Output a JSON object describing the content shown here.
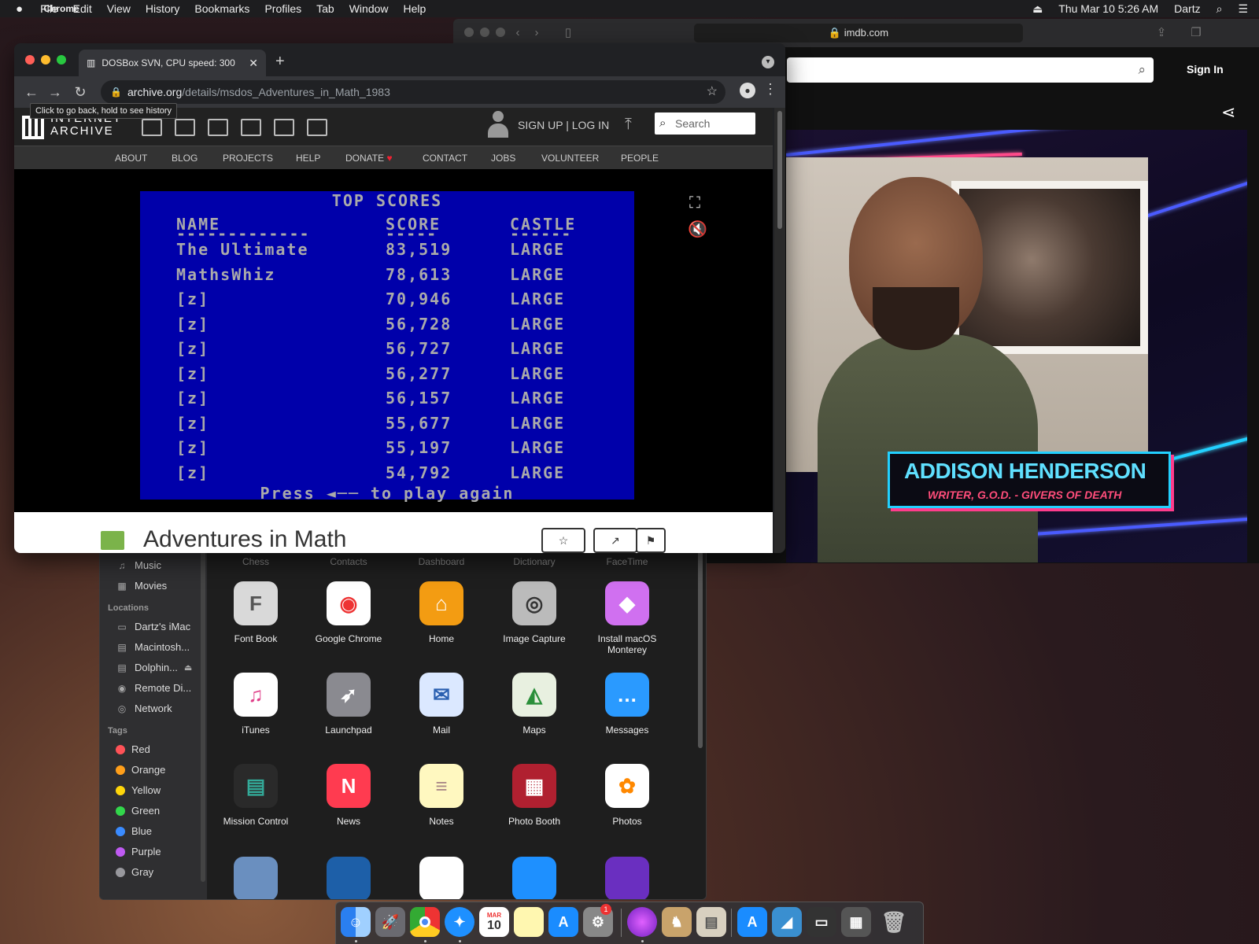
{
  "menubar": {
    "apple": "",
    "items": [
      "Chrome",
      "File",
      "Edit",
      "View",
      "History",
      "Bookmarks",
      "Profiles",
      "Tab",
      "Window",
      "Help"
    ],
    "datetime": "Thu Mar 10  5:26 AM",
    "user": "Dartz"
  },
  "safari": {
    "url": "imdb.com",
    "sign_in": "Sign In",
    "lower_third_name": "ADDISON HENDERSON",
    "lower_third_role": "WRITER, G.O.D. - GIVERS OF DEATH"
  },
  "chrome": {
    "tab_title": "DOSBox SVN, CPU speed: 300",
    "url_host": "archive.org",
    "url_path": "/details/msdos_Adventures_in_Math_1983",
    "tooltip": "Click to go back, hold to see history"
  },
  "ia": {
    "logo_line1": "INTERNET",
    "logo_line2": "ARCHIVE",
    "signup": "SIGN UP | LOG IN",
    "search_placeholder": "Search",
    "nav": [
      "ABOUT",
      "BLOG",
      "PROJECTS",
      "HELP",
      "DONATE",
      "CONTACT",
      "JOBS",
      "VOLUNTEER",
      "PEOPLE"
    ],
    "item_title": "Adventures in Math"
  },
  "dos": {
    "title": "TOP SCORES",
    "headers": {
      "name": "NAME",
      "score": "SCORE",
      "castle": "CASTLE"
    },
    "rows": [
      {
        "name": "The Ultimate",
        "score": "83,519",
        "castle": "LARGE"
      },
      {
        "name": "MathsWhiz",
        "score": "78,613",
        "castle": "LARGE"
      },
      {
        "name": "[z]",
        "score": "70,946",
        "castle": "LARGE"
      },
      {
        "name": "[z]",
        "score": "56,728",
        "castle": "LARGE"
      },
      {
        "name": "[z]",
        "score": "56,727",
        "castle": "LARGE"
      },
      {
        "name": "[z]",
        "score": "56,277",
        "castle": "LARGE"
      },
      {
        "name": "[z]",
        "score": "56,157",
        "castle": "LARGE"
      },
      {
        "name": "[z]",
        "score": "55,677",
        "castle": "LARGE"
      },
      {
        "name": "[z]",
        "score": "55,197",
        "castle": "LARGE"
      },
      {
        "name": "[z]",
        "score": "54,792",
        "castle": "LARGE"
      }
    ],
    "footer": "Press ◄── to play again"
  },
  "finder": {
    "favorites": [
      "Music",
      "Movies"
    ],
    "locations_header": "Locations",
    "locations": [
      "Dartz's iMac",
      "Macintosh...",
      "Dolphin...",
      "Remote Di...",
      "Network"
    ],
    "tags_header": "Tags",
    "tags": [
      {
        "label": "Red",
        "color": "#ff5257"
      },
      {
        "label": "Orange",
        "color": "#ff9f1a"
      },
      {
        "label": "Yellow",
        "color": "#ffd60a"
      },
      {
        "label": "Green",
        "color": "#32d74b"
      },
      {
        "label": "Blue",
        "color": "#3a8bff"
      },
      {
        "label": "Purple",
        "color": "#bf5af2"
      },
      {
        "label": "Gray",
        "color": "#98989d"
      }
    ],
    "top_row": [
      "Chess",
      "Contacts",
      "Dashboard",
      "Dictionary",
      "FaceTime"
    ],
    "apps": [
      [
        "Font Book",
        "Google Chrome",
        "Home",
        "Image Capture",
        "Install macOS Monterey"
      ],
      [
        "iTunes",
        "Launchpad",
        "Mail",
        "Maps",
        "Messages"
      ],
      [
        "Mission Control",
        "News",
        "Notes",
        "Photo Booth",
        "Photos"
      ]
    ]
  },
  "dock": {
    "calendar_month": "MAR",
    "calendar_day": "10",
    "badge": "1"
  }
}
